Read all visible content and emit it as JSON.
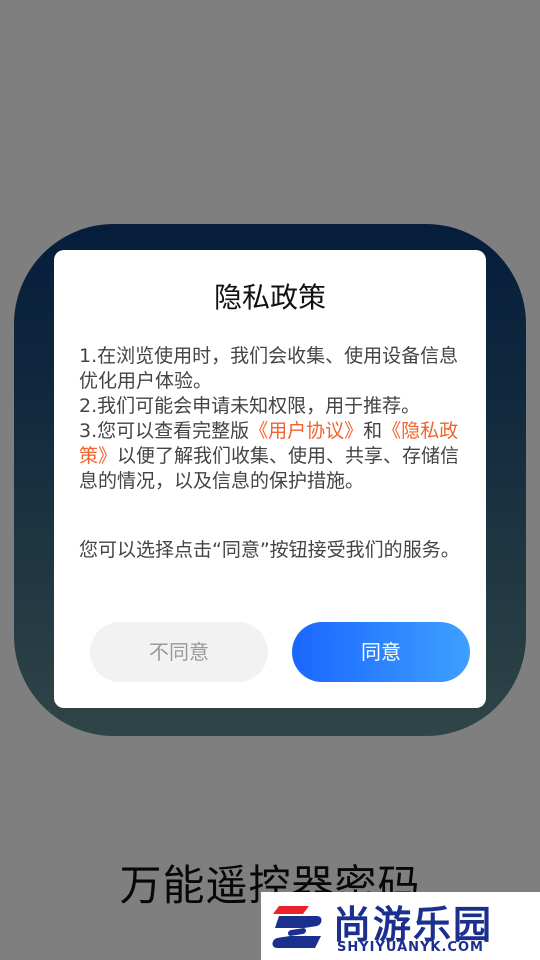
{
  "splash": {
    "app_name": "万能遥控器密码"
  },
  "dialog": {
    "title": "隐私政策",
    "line1": "1.在浏览使用时，我们会收集、使用设备信息优化用户体验。",
    "line2": "2.我们可能会申请未知权限，用于推荐。",
    "line3_prefix": "3.您可以查看完整版",
    "user_agreement_link": "《用户协议》",
    "line3_and": "和",
    "privacy_policy_link": "《隐私政策》",
    "line3_suffix": "以便了解我们收集、使用、共享、存储信息的情况，以及信息的保护措施。",
    "note": "您可以选择点击“同意”按钮接受我们的服务。",
    "disagree_label": "不同意",
    "agree_label": "同意"
  },
  "watermark": {
    "brand": "尚游乐园",
    "url": "SHYIYUANYK.COM"
  },
  "colors": {
    "link": "#f2622d",
    "agree_start": "#1a66ff",
    "agree_end": "#3ea0ff",
    "icon_top": "#0c3b79",
    "icon_bottom": "#5f8a8f"
  }
}
